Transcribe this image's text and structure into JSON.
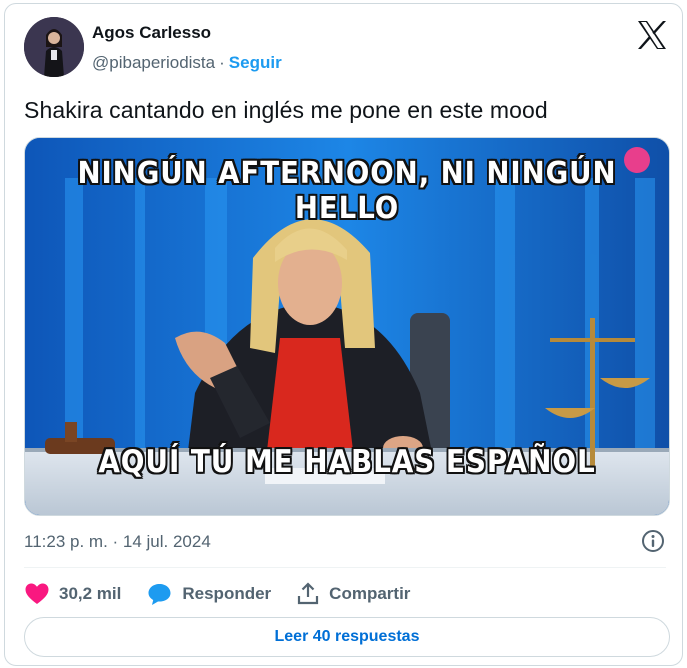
{
  "author": {
    "name": "Agos Carlesso",
    "handle": "@pibaperiodista",
    "separator": "·",
    "follow_label": "Seguir"
  },
  "platform_icon": "x-logo-icon",
  "tweet": {
    "text": "Shakira cantando en inglés me pone en este mood"
  },
  "media": {
    "caption_top": "NINGÚN AFTERNOON, NI NINGÚN HELLO",
    "caption_bottom": "AQUÍ TÚ ME HABLAS ESPAÑOL"
  },
  "meta": {
    "timestamp": "11:23 p. m. · 14 jul. 2024",
    "info_icon": "info-icon"
  },
  "actions": {
    "likes_count": "30,2 mil",
    "reply_label": "Responder",
    "share_label": "Compartir"
  },
  "read_replies_label": "Leer 40 respuestas",
  "colors": {
    "accent": "#1d9bf0",
    "link": "#006fd6",
    "heart": "#f91880",
    "muted": "#536471"
  }
}
